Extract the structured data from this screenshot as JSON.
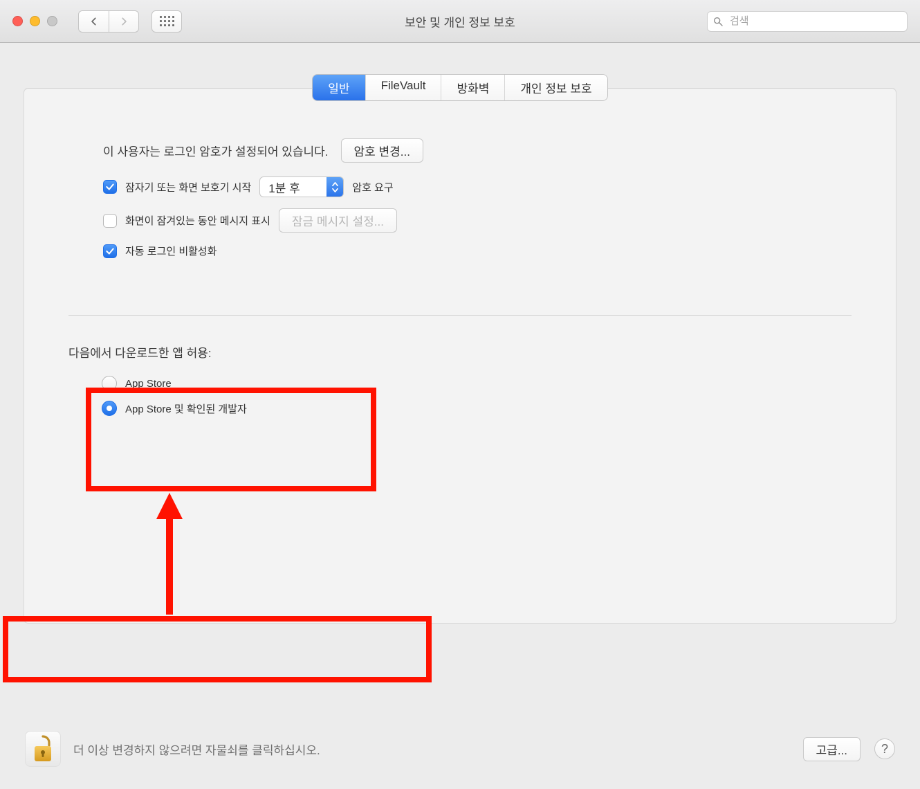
{
  "window": {
    "title": "보안 및 개인 정보 보호"
  },
  "search": {
    "placeholder": "검색"
  },
  "tabs": {
    "general": "일반",
    "filevault": "FileVault",
    "firewall": "방화벽",
    "privacy": "개인 정보 보호"
  },
  "general": {
    "login_password_set": "이 사용자는 로그인 암호가 설정되어 있습니다.",
    "change_password_button": "암호 변경...",
    "require_password_label": "잠자기 또는 화면 보호기 시작",
    "require_password_delay": "1분 후",
    "require_password_suffix": "암호 요구",
    "show_message_label": "화면이 잠겨있는 동안 메시지 표시",
    "set_lock_message_button": "잠금 메시지 설정...",
    "disable_auto_login_label": "자동 로그인 비활성화"
  },
  "gatekeeper": {
    "heading": "다음에서 다운로드한 앱 허용:",
    "option_appstore": "App Store",
    "option_identified": "App Store 및 확인된 개발자"
  },
  "lock_hint": "더 이상 변경하지 않으려면 자물쇠를 클릭하십시오.",
  "advanced_button": "고급...",
  "help_label": "?"
}
